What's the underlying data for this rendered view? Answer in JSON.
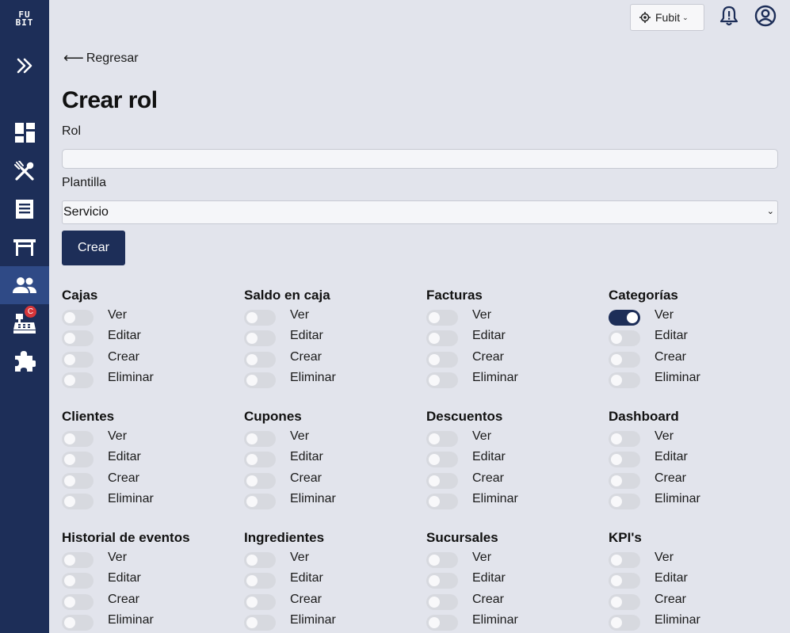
{
  "app": {
    "logo_text": "FU BIT",
    "branch_label": "Fubit"
  },
  "colors": {
    "sidebar": "#1d2e58",
    "accent": "#1d2e58",
    "background": "#e2e4ec",
    "badge": "#d6363a"
  },
  "sidebar": {
    "items": [
      {
        "name": "expand",
        "icon": "double-chevron-right-icon"
      },
      {
        "name": "dashboard",
        "icon": "dashboard-icon"
      },
      {
        "name": "menu",
        "icon": "utensils-icon"
      },
      {
        "name": "orders",
        "icon": "receipt-icon"
      },
      {
        "name": "tables",
        "icon": "table-icon"
      },
      {
        "name": "users",
        "icon": "users-icon",
        "active": true
      },
      {
        "name": "cashier",
        "icon": "cash-register-icon",
        "badge": "C"
      },
      {
        "name": "plugins",
        "icon": "puzzle-icon"
      }
    ]
  },
  "nav": {
    "back_label": "Regresar"
  },
  "form": {
    "title": "Crear rol",
    "role_label": "Rol",
    "role_value": "",
    "template_label": "Plantilla",
    "template_value": "Servicio",
    "submit_label": "Crear"
  },
  "permissions": [
    {
      "title": "Cajas",
      "items": [
        {
          "label": "Ver",
          "on": false
        },
        {
          "label": "Editar",
          "on": false
        },
        {
          "label": "Crear",
          "on": false
        },
        {
          "label": "Eliminar",
          "on": false
        }
      ]
    },
    {
      "title": "Saldo en caja",
      "items": [
        {
          "label": "Ver",
          "on": false
        },
        {
          "label": "Editar",
          "on": false
        },
        {
          "label": "Crear",
          "on": false
        },
        {
          "label": "Eliminar",
          "on": false
        }
      ]
    },
    {
      "title": "Facturas",
      "items": [
        {
          "label": "Ver",
          "on": false
        },
        {
          "label": "Editar",
          "on": false
        },
        {
          "label": "Crear",
          "on": false
        },
        {
          "label": "Eliminar",
          "on": false
        }
      ]
    },
    {
      "title": "Categorías",
      "items": [
        {
          "label": "Ver",
          "on": true
        },
        {
          "label": "Editar",
          "on": false
        },
        {
          "label": "Crear",
          "on": false
        },
        {
          "label": "Eliminar",
          "on": false
        }
      ]
    },
    {
      "title": "Clientes",
      "items": [
        {
          "label": "Ver",
          "on": false
        },
        {
          "label": "Editar",
          "on": false
        },
        {
          "label": "Crear",
          "on": false
        },
        {
          "label": "Eliminar",
          "on": false
        }
      ]
    },
    {
      "title": "Cupones",
      "items": [
        {
          "label": "Ver",
          "on": false
        },
        {
          "label": "Editar",
          "on": false
        },
        {
          "label": "Crear",
          "on": false
        },
        {
          "label": "Eliminar",
          "on": false
        }
      ]
    },
    {
      "title": "Descuentos",
      "items": [
        {
          "label": "Ver",
          "on": false
        },
        {
          "label": "Editar",
          "on": false
        },
        {
          "label": "Crear",
          "on": false
        },
        {
          "label": "Eliminar",
          "on": false
        }
      ]
    },
    {
      "title": "Dashboard",
      "items": [
        {
          "label": "Ver",
          "on": false
        },
        {
          "label": "Editar",
          "on": false
        },
        {
          "label": "Crear",
          "on": false
        },
        {
          "label": "Eliminar",
          "on": false
        }
      ]
    },
    {
      "title": "Historial de eventos",
      "items": [
        {
          "label": "Ver",
          "on": false
        },
        {
          "label": "Editar",
          "on": false
        },
        {
          "label": "Crear",
          "on": false
        },
        {
          "label": "Eliminar",
          "on": false
        }
      ]
    },
    {
      "title": "Ingredientes",
      "items": [
        {
          "label": "Ver",
          "on": false
        },
        {
          "label": "Editar",
          "on": false
        },
        {
          "label": "Crear",
          "on": false
        },
        {
          "label": "Eliminar",
          "on": false
        }
      ]
    },
    {
      "title": "Sucursales",
      "items": [
        {
          "label": "Ver",
          "on": false
        },
        {
          "label": "Editar",
          "on": false
        },
        {
          "label": "Crear",
          "on": false
        },
        {
          "label": "Eliminar",
          "on": false
        }
      ]
    },
    {
      "title": "KPI's",
      "items": [
        {
          "label": "Ver",
          "on": false
        },
        {
          "label": "Editar",
          "on": false
        },
        {
          "label": "Crear",
          "on": false
        },
        {
          "label": "Eliminar",
          "on": false
        }
      ]
    }
  ]
}
